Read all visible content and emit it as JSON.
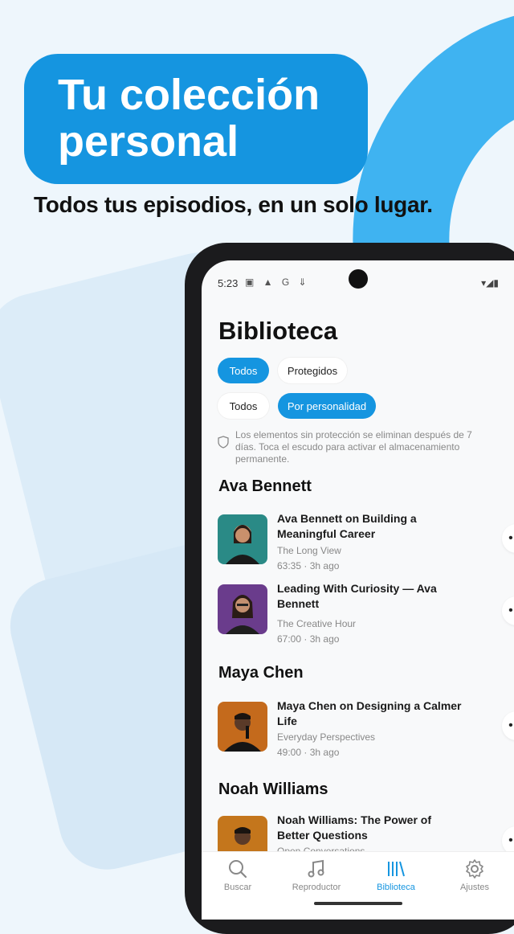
{
  "promo": {
    "headline_line1": "Tu colección",
    "headline_line2": "personal",
    "subhead": "Todos tus episodios, en un solo lugar.",
    "accent": "#1595e0"
  },
  "status": {
    "time": "5:23",
    "icons": "▣ ▲ G ⇓",
    "right": "▾◢▮"
  },
  "screen": {
    "title": "Biblioteca",
    "filters_primary": [
      {
        "label": "Todos",
        "active": true
      },
      {
        "label": "Protegidos",
        "active": false
      }
    ],
    "filters_secondary": [
      {
        "label": "Todos",
        "active": false
      },
      {
        "label": "Por personalidad",
        "active": true
      }
    ],
    "notice": "Los elementos sin protección se eliminan después de 7 días. Toca el escudo para activar el almacenamiento permanente."
  },
  "groups": [
    {
      "name": "Ava Bennett",
      "episodes": [
        {
          "title": "Ava Bennett on Building a Meaningful Career",
          "show": "The Long View",
          "duration": "63:35",
          "age": "3h ago"
        },
        {
          "title": "Leading With Curiosity — Ava Bennett",
          "show": "The Creative Hour",
          "duration": "67:00",
          "age": "3h ago"
        }
      ]
    },
    {
      "name": "Maya Chen",
      "episodes": [
        {
          "title": "Maya Chen on Designing a Calmer Life",
          "show": "Everyday Perspectives",
          "duration": "49:00",
          "age": "3h ago"
        }
      ]
    },
    {
      "name": "Noah Williams",
      "episodes": [
        {
          "title": "Noah Williams: The Power of Better Questions",
          "show": "Open Conversations",
          "duration": "",
          "age": ""
        }
      ]
    }
  ],
  "more_label": "•••",
  "meta_separator": "·",
  "tabs": [
    {
      "label": "Buscar",
      "icon": "search-icon",
      "active": false
    },
    {
      "label": "Reproductor",
      "icon": "music-note-icon",
      "active": false
    },
    {
      "label": "Biblioteca",
      "icon": "library-icon",
      "active": true
    },
    {
      "label": "Ajustes",
      "icon": "gear-icon",
      "active": false
    }
  ]
}
